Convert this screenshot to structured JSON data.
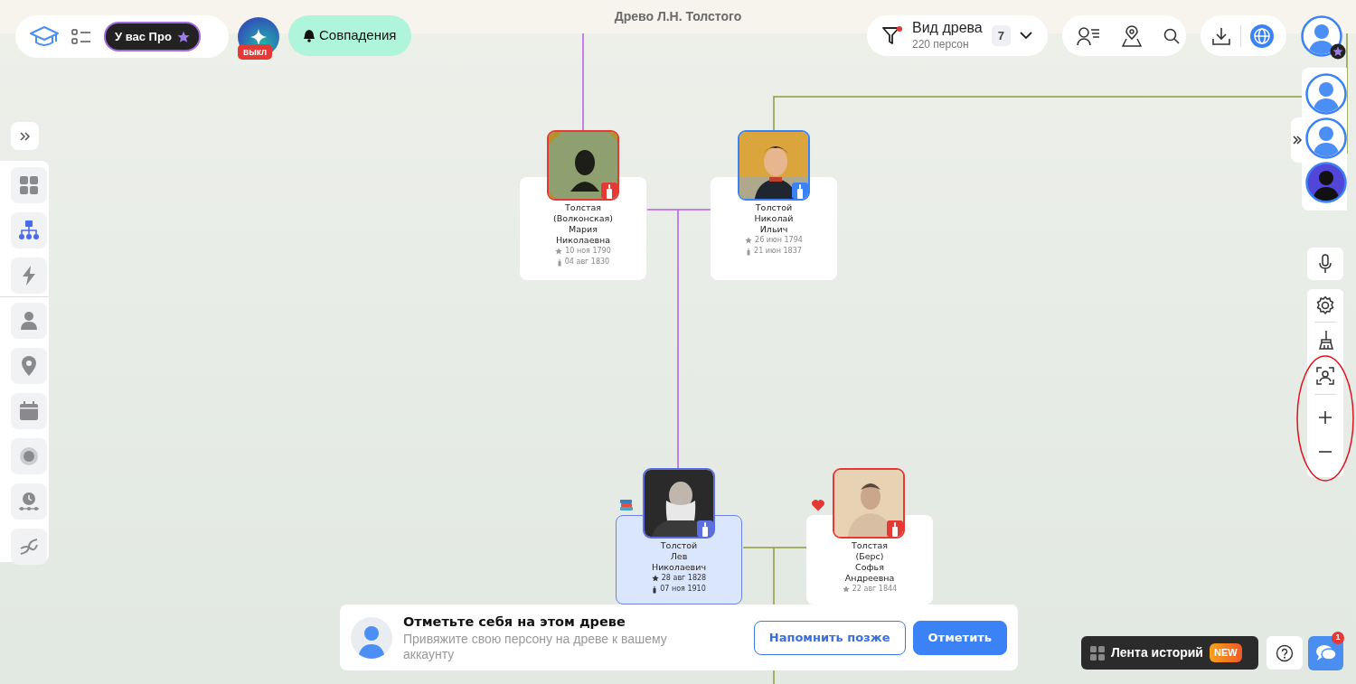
{
  "window": {
    "title": "Древо Л.Н. Толстого"
  },
  "toolbar": {
    "pro_badge": "У вас Про",
    "ai_toggle": {
      "on": false,
      "label": "выкл"
    },
    "matches_button": "Совпадения"
  },
  "tree_view": {
    "title": "Вид древа",
    "subtitle": "220 персон",
    "count": "7",
    "filter_active": true
  },
  "sidebar": {
    "items": [
      {
        "kind": "grid",
        "selected": false
      },
      {
        "kind": "tree",
        "selected": true
      },
      {
        "kind": "bolt",
        "selected": false
      },
      {
        "kind": "person",
        "selected": false
      },
      {
        "kind": "pin",
        "selected": false
      },
      {
        "kind": "calendar",
        "selected": false
      },
      {
        "kind": "radar",
        "selected": false
      },
      {
        "kind": "timeline",
        "selected": false
      },
      {
        "kind": "dna",
        "selected": false
      }
    ]
  },
  "persons": [
    {
      "name_lines": [
        "Толстая",
        "(Волконская)",
        "Мария",
        "Николаевна"
      ],
      "birth": "10 ноя 1790",
      "death": "04 авг 1830",
      "color": "#e53935",
      "selected": false
    },
    {
      "name_lines": [
        "Толстой",
        "Николай",
        "Ильич"
      ],
      "birth": "26 июн 1794",
      "death": "21 июн 1837",
      "color": "#3b82f6",
      "selected": false
    },
    {
      "name_lines": [
        "Толстой",
        "Лев",
        "Николаевич"
      ],
      "birth": "28 авг 1828",
      "death": "07 ноя 1910",
      "color": "#5b6fe0",
      "selected": true,
      "marker": {
        "kind": "books"
      }
    },
    {
      "name_lines": [
        "Толстая",
        "(Берс)",
        "Софья",
        "Андреевна"
      ],
      "birth": "22 авг 1844",
      "color": "#e53935",
      "selected": false,
      "marker": {
        "kind": "heart"
      }
    }
  ],
  "banner": {
    "title": "Отметьте себя на этом древе",
    "text": "Привяжите свою персону на древе к вашему аккаунту",
    "buttons": [
      {
        "label": "Напомнить позже",
        "kind": "outline"
      },
      {
        "label": "Отметить",
        "kind": "primary"
      }
    ]
  },
  "stories_button": {
    "label": "Лента историй",
    "badge": "NEW"
  },
  "chat": {
    "badge": "1"
  }
}
